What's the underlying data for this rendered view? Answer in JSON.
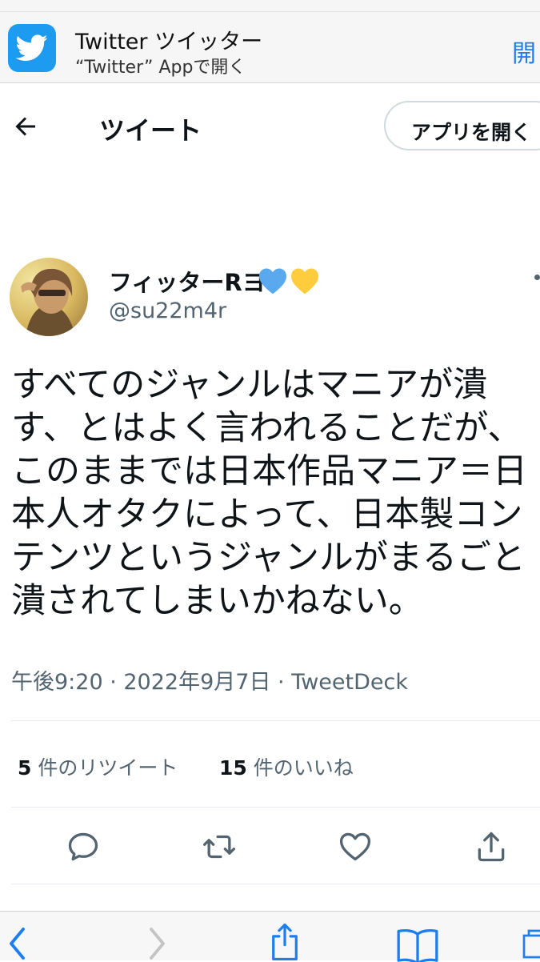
{
  "banner": {
    "app_title": "Twitter ツイッター",
    "app_subtitle": "“Twitter” Appで開く",
    "open_label": "開",
    "icon": "twitter-bird-icon",
    "accent": "#1d9bf0"
  },
  "header": {
    "title": "ツイート",
    "open_app_label": "アプリを開く"
  },
  "tweet": {
    "display_name": "フィッターRヨ",
    "handle": "@su22m4r",
    "text_lines": [
      "すべてのジャンルはマニアが潰",
      "す、とはよく言われることだが、",
      "このままでは日本作品マニア＝日",
      "本人オタクによって、日本製コン",
      "テンツというジャンルがまるごと",
      "潰されてしまいかねない。"
    ],
    "meta": "午後9:20 · 2022年9月7日 · TweetDeck",
    "retweet_count": "5",
    "retweet_label": " 件のリツイート",
    "like_count": "15",
    "like_label": " 件のいいね"
  },
  "colors": {
    "text": "#0f1419",
    "secondary": "#536471",
    "heart_blue": "#5aa9ee",
    "heart_yellow": "#ffcc3e"
  }
}
